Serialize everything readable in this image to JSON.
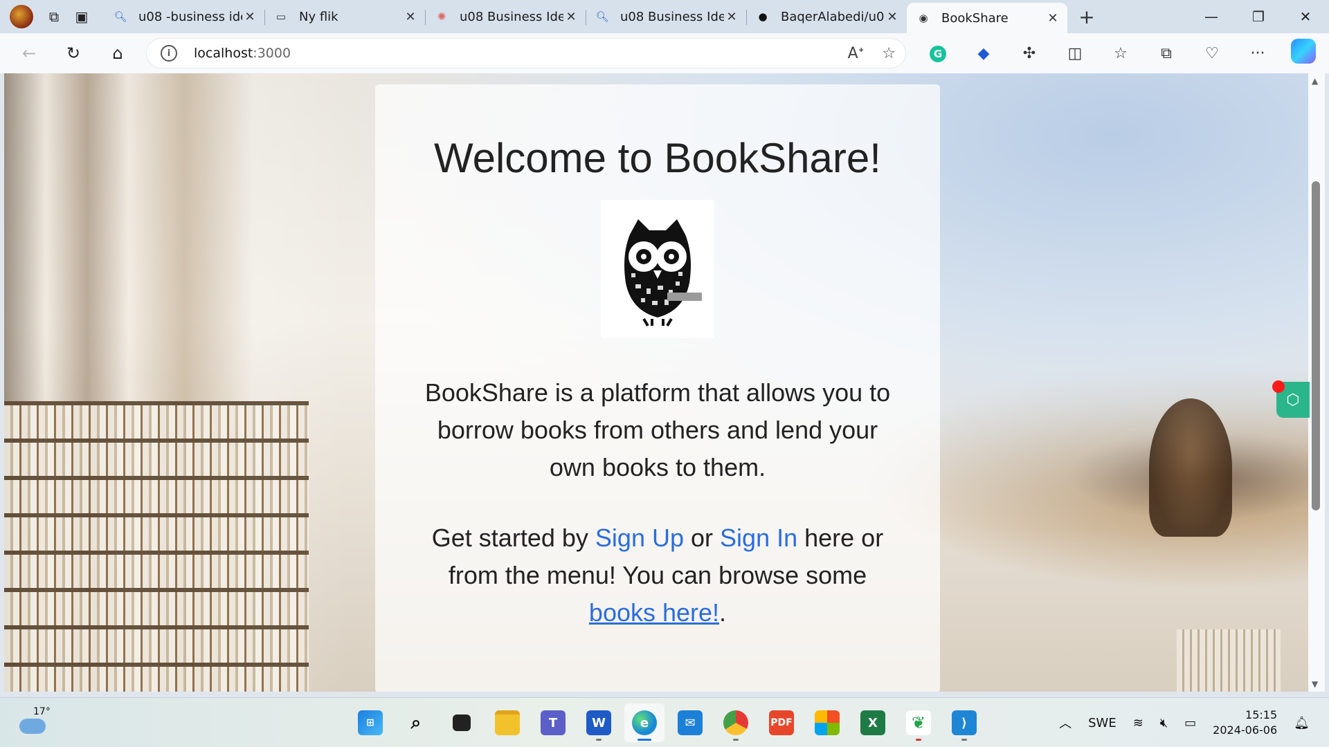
{
  "browser": {
    "tabs": [
      {
        "title": "u08 -business ide",
        "icon": "search-icon"
      },
      {
        "title": "Ny flik",
        "icon": "new-tab-page-icon"
      },
      {
        "title": "u08 Business Ide",
        "icon": "trello-icon"
      },
      {
        "title": "u08 Business Ide",
        "icon": "search-icon"
      },
      {
        "title": "BaqerAlabedi/u0",
        "icon": "github-icon"
      },
      {
        "title": "BookShare",
        "icon": "owl-icon",
        "active": true
      }
    ],
    "address": {
      "host": "localhost",
      "port": ":3000"
    }
  },
  "page": {
    "heading": "Welcome to BookShare!",
    "intro": "BookShare is a platform that allows you to borrow books from others and lend your own books to them.",
    "cta_prefix": "Get started by",
    "signup_link": "Sign Up",
    "cta_or": "or",
    "signin_link": "Sign In",
    "cta_middle": "here or from the menu! You can browse some",
    "books_link": "books here!",
    "cta_suffix": "."
  },
  "taskbar": {
    "weather_temp": "17°",
    "language": "SWE",
    "time": "15:15",
    "date": "2024-06-06",
    "apps": [
      "start-icon",
      "search-icon",
      "task-view-icon",
      "file-explorer-icon",
      "teams-icon",
      "word-icon",
      "edge-icon",
      "mail-icon",
      "chrome-icon",
      "pdf-reader-icon",
      "store-icon",
      "excel-icon",
      "mongodb-compass-icon",
      "vscode-icon"
    ]
  }
}
